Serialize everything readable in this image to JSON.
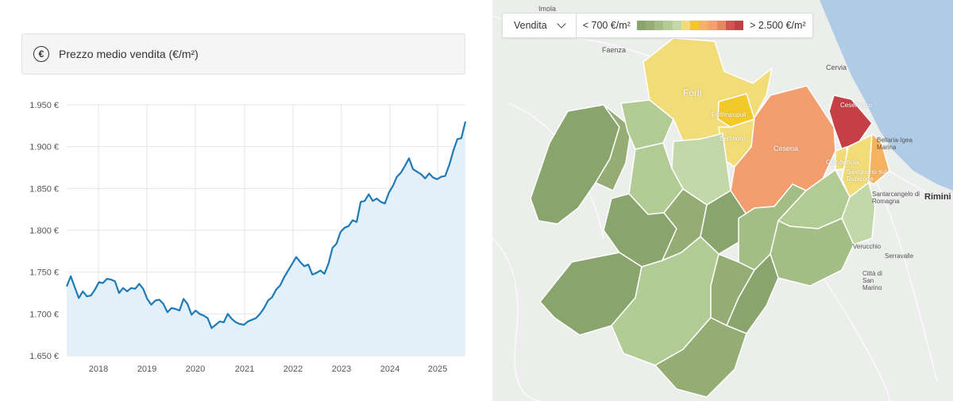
{
  "chart": {
    "header_title": "Prezzo medio vendita (€/m²)",
    "euro_symbol": "€"
  },
  "chart_data": {
    "type": "area",
    "title": "Prezzo medio vendita (€/m²)",
    "xlabel": "",
    "ylabel": "",
    "y_ticks": [
      "1.950 €",
      "1.900 €",
      "1.850 €",
      "1.800 €",
      "1.750 €",
      "1.700 €",
      "1.650 €"
    ],
    "y_tick_values": [
      1950,
      1900,
      1850,
      1800,
      1750,
      1700,
      1650
    ],
    "x_ticks": [
      "2018",
      "2019",
      "2020",
      "2021",
      "2022",
      "2023",
      "2024",
      "2025"
    ],
    "ylim": [
      1650,
      1950
    ],
    "grid": true,
    "line_color": "#1f7ab8",
    "fill_color": "#e3eff9",
    "series": [
      {
        "values": [
          1733,
          1745,
          1732,
          1719,
          1727,
          1721,
          1722,
          1729,
          1738,
          1737,
          1742,
          1741,
          1739,
          1725,
          1731,
          1727,
          1731,
          1730,
          1736,
          1730,
          1718,
          1711,
          1716,
          1717,
          1712,
          1702,
          1707,
          1706,
          1704,
          1718,
          1712,
          1699,
          1704,
          1700,
          1698,
          1695,
          1683,
          1687,
          1691,
          1690,
          1700,
          1694,
          1690,
          1688,
          1687,
          1691,
          1693,
          1695,
          1700,
          1707,
          1716,
          1720,
          1729,
          1734,
          1744,
          1752,
          1760,
          1768,
          1762,
          1757,
          1759,
          1747,
          1749,
          1752,
          1748,
          1760,
          1779,
          1784,
          1798,
          1803,
          1805,
          1812,
          1810,
          1834,
          1835,
          1843,
          1835,
          1838,
          1834,
          1832,
          1845,
          1853,
          1864,
          1869,
          1877,
          1886,
          1873,
          1870,
          1867,
          1862,
          1868,
          1863,
          1861,
          1864,
          1865,
          1878,
          1895,
          1909,
          1910,
          1930
        ]
      }
    ]
  },
  "map": {
    "mode_label": "Vendita",
    "legend_min": "< 700 €/m²",
    "legend_max": "> 2.500 €/m²",
    "scale_colors": [
      "#8aa46e",
      "#95ad75",
      "#a3bd85",
      "#b2cb95",
      "#c3d8a8",
      "#f2dc78",
      "#f3c92a",
      "#f6b35f",
      "#f29e6f",
      "#ed8460",
      "#d8504f",
      "#c44044"
    ],
    "places": {
      "imola": "Imola",
      "faenza": "Faenza",
      "cervia": "Cervia",
      "forli": "Forlì",
      "forlimpopoli": "Forlimpopoli",
      "bertinoro": "Bertinoro",
      "cesena": "Cesena",
      "cesenatico": "Cesenatico",
      "bellaria": "Bellaria-Igea Marina",
      "gambettola": "Gambettola",
      "savignano": "Savignano sul Rubicone",
      "santarcangelo": "Santarcangelo di Romagna",
      "rimini": "Rimini",
      "verucchio": "Verucchio",
      "serravalle": "Serravalle",
      "san_marino": "Città di San Marino"
    }
  }
}
